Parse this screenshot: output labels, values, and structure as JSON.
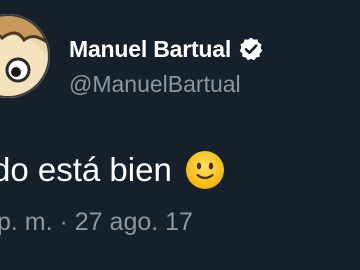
{
  "author": {
    "display_name": "Manuel Bartual",
    "handle": "@ManuelBartual",
    "verified_icon": "verified-badge-icon",
    "avatar_icon": "cartoon-avatar"
  },
  "tweet": {
    "text": "do está bien",
    "emoji": "slightly-smiling-face-icon",
    "timestamp": "p. m. · 27 ago. 17"
  },
  "colors": {
    "background": "#15202b",
    "primary_text": "#ffffff",
    "secondary_text": "#8899a6"
  }
}
